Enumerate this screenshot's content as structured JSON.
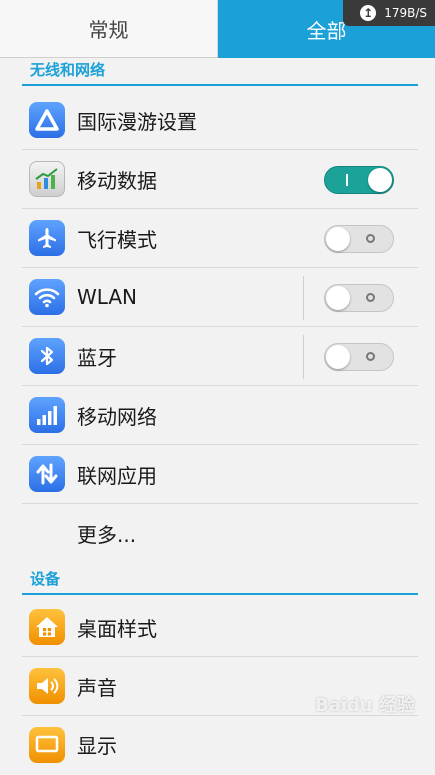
{
  "tabs": {
    "general": "常规",
    "all": "全部"
  },
  "status": {
    "net_speed": "179B/S"
  },
  "sections": {
    "wireless": "无线和网络",
    "device": "设备"
  },
  "items": {
    "roaming": "国际漫游设置",
    "mobile_data": "移动数据",
    "airplane": "飞行模式",
    "wlan": "WLAN",
    "bluetooth": "蓝牙",
    "mobile_network": "移动网络",
    "network_apps": "联网应用",
    "more": "更多...",
    "home_style": "桌面样式",
    "sound": "声音",
    "display": "显示"
  },
  "watermark": "Baidu 经验",
  "colors": {
    "accent": "#1ba1d7",
    "switch_on": "#1ba39a"
  },
  "toggles": {
    "mobile_data": "on",
    "airplane": "off",
    "wlan": "off",
    "bluetooth": "off"
  }
}
